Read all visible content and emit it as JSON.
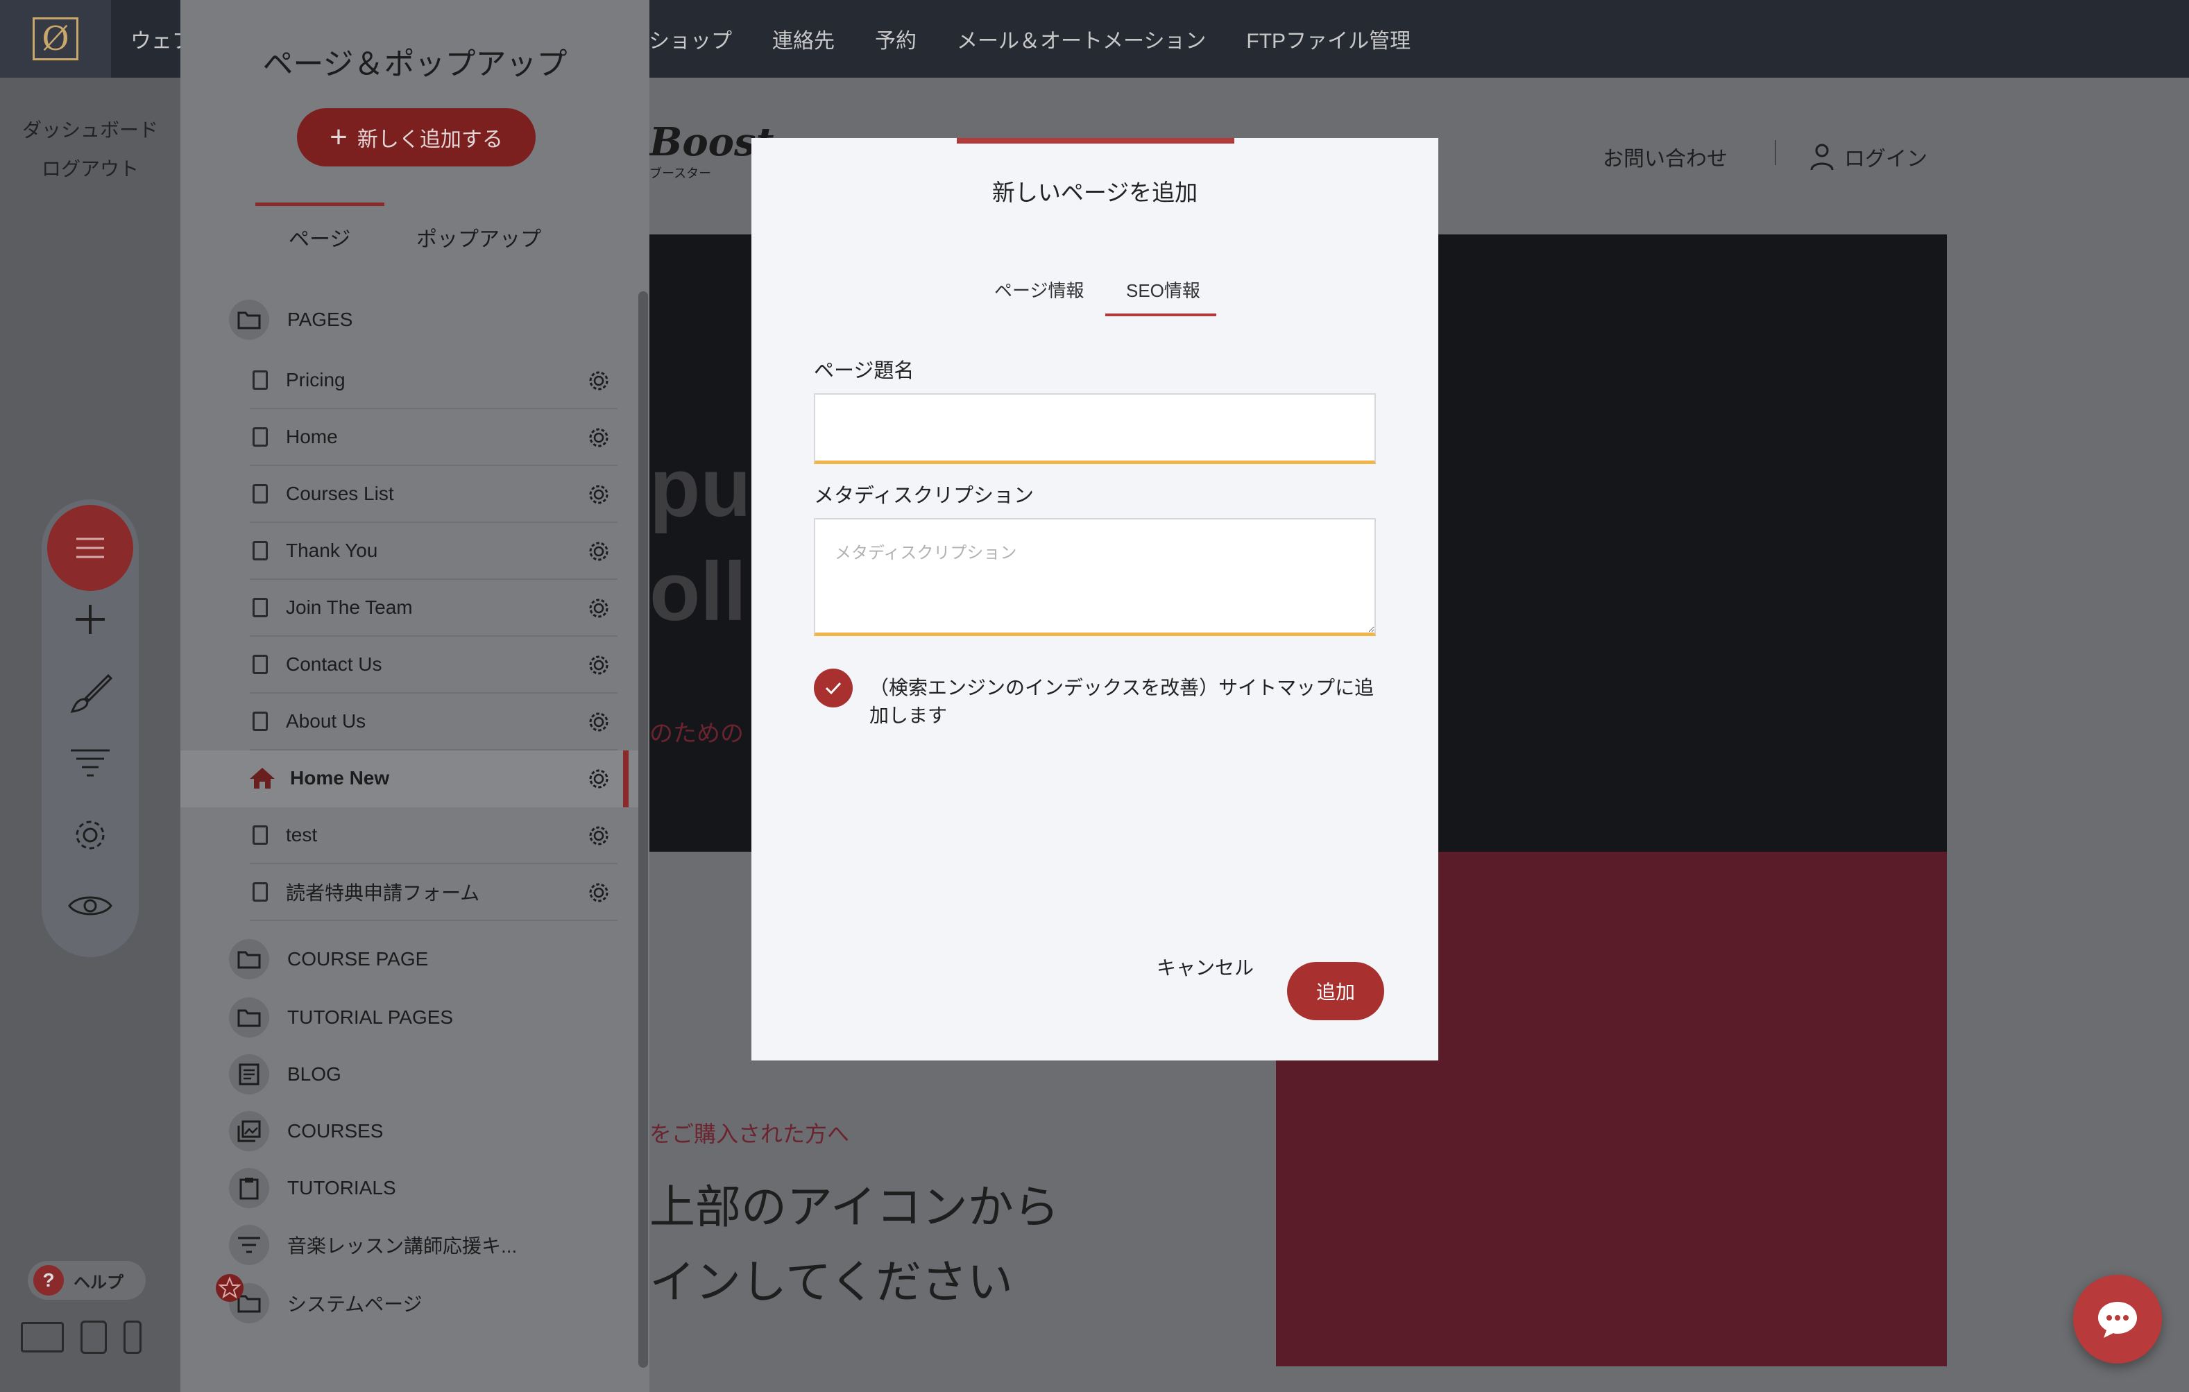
{
  "topbar": {
    "logo_text": "Ø",
    "nav_left": "ウェブ",
    "nav": [
      "ショップ",
      "連絡先",
      "予約",
      "メール＆オートメーション",
      "FTPファイル管理"
    ]
  },
  "leftrail": {
    "dashboard": "ダッシュボード",
    "logout": "ログアウト",
    "help": "ヘルプ"
  },
  "site": {
    "brand": "Boost",
    "brand_sub": "ブースター",
    "contact": "お問い合わせ",
    "login": "ログイン",
    "hero_line1": "pu",
    "hero_line2": "oll",
    "hero_red": "のための",
    "sub_red": "をご購入された方へ",
    "sub_line1": "上部のアイコンから",
    "sub_line2": "インしてください"
  },
  "panel": {
    "title": "ページ＆ポップアップ",
    "add_new": "新しく追加する",
    "tab_pages": "ページ",
    "tab_popups": "ポップアップ",
    "folder_pages": "PAGES",
    "pages": [
      "Pricing",
      "Home",
      "Courses List",
      "Thank You",
      "Join The Team",
      "Contact Us",
      "About Us",
      "Home New",
      "test",
      "読者特典申請フォーム"
    ],
    "folders": [
      "COURSE PAGE",
      "TUTORIAL PAGES",
      "BLOG",
      "COURSES",
      "TUTORIALS",
      "音楽レッスン講師応援キ...",
      "システムページ"
    ]
  },
  "modal": {
    "title": "新しいページを追加",
    "tab_page_info": "ページ情報",
    "tab_seo": "SEO情報",
    "page_title_label": "ページ題名",
    "page_title_value": "",
    "meta_label": "メタディスクリプション",
    "meta_placeholder": "メタディスクリプション",
    "meta_value": "",
    "sitemap_text": "（検索エンジンのインデックスを改善）サイトマップに追加します",
    "sitemap_checked": true,
    "cancel": "キャンセル",
    "add": "追加"
  },
  "colors": {
    "accent": "#a8312f",
    "input_underline": "#f0b54a",
    "overlay_dark": "#262a33"
  }
}
